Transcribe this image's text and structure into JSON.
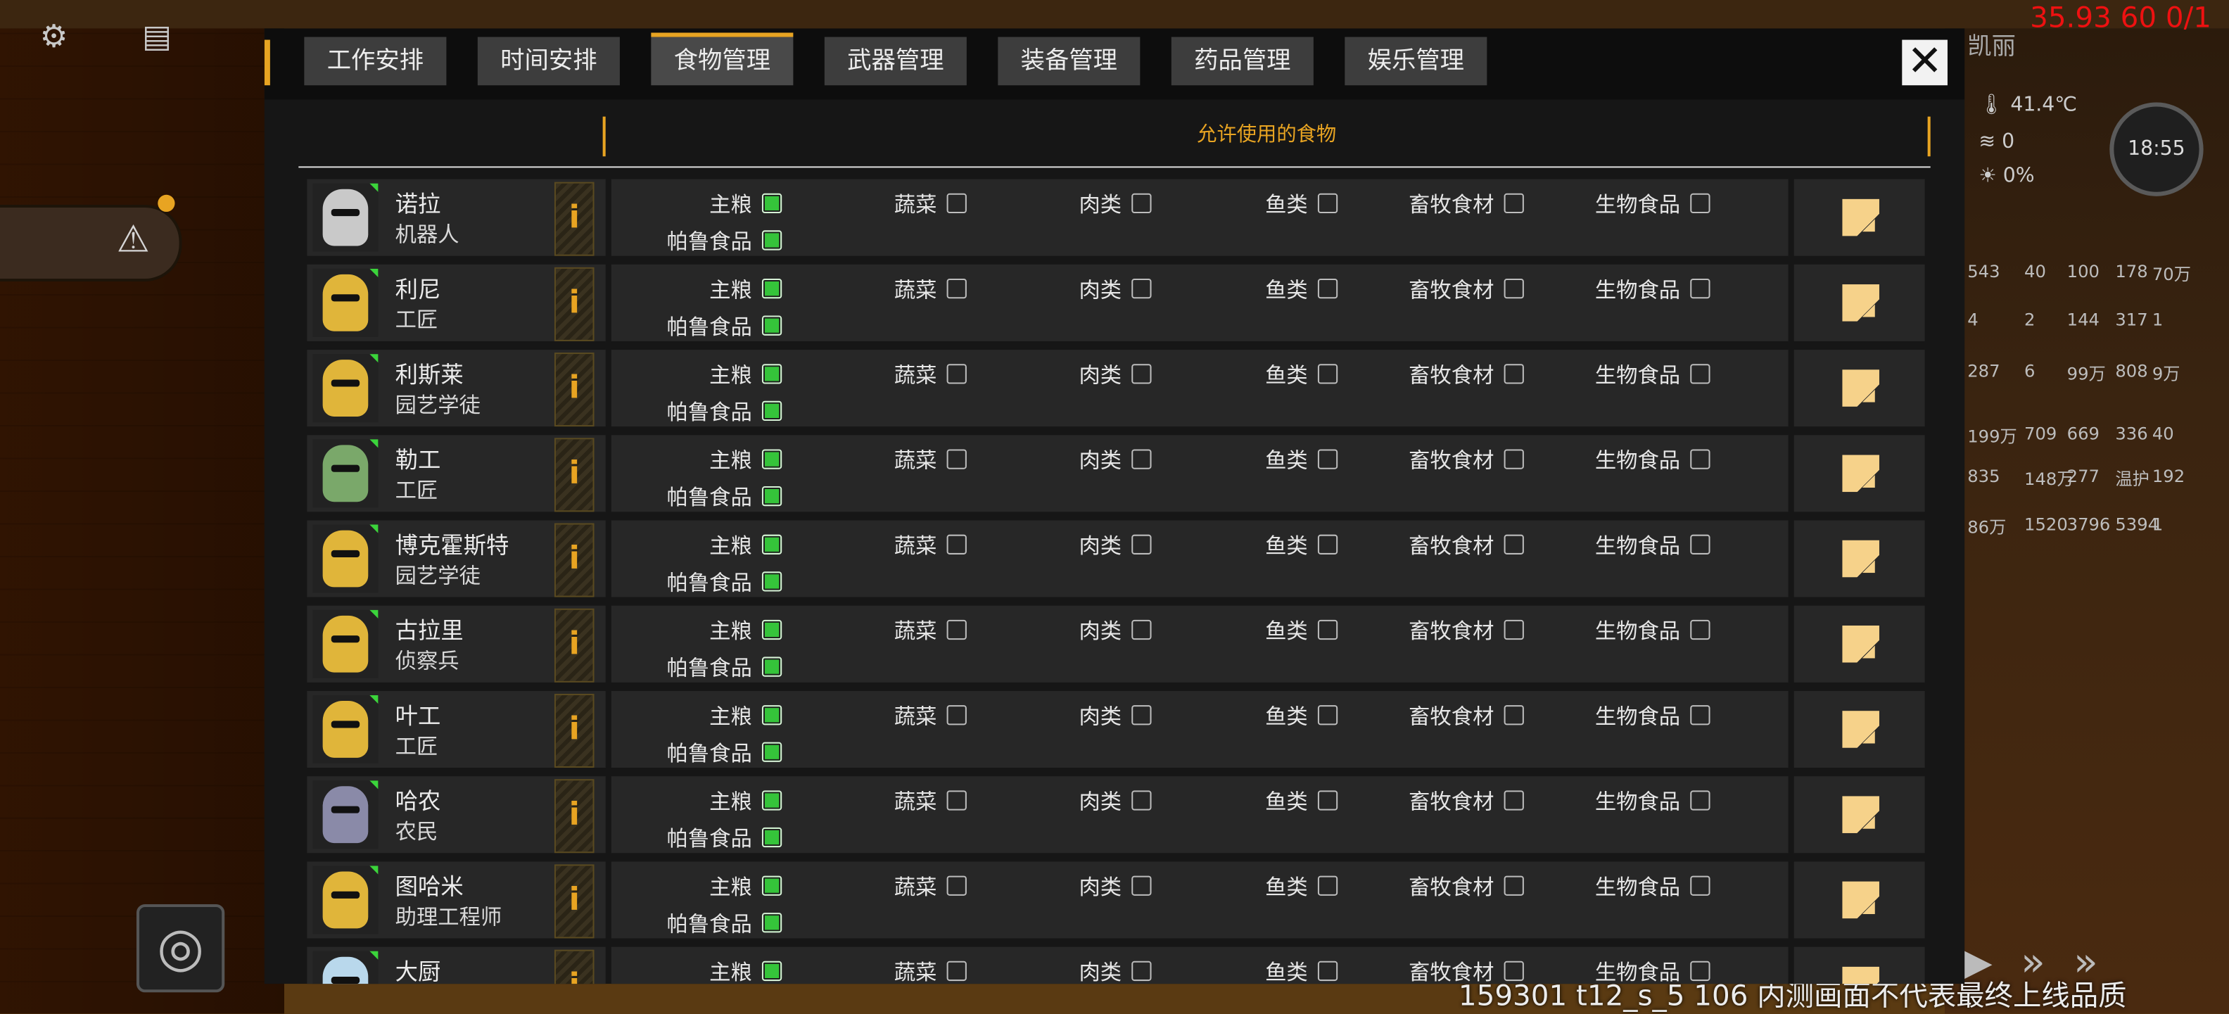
{
  "hud": {
    "top_stats": "35.93 60 0/1",
    "top_name": "凯丽",
    "temperature": "41.4℃",
    "wind": "0",
    "light": "0%",
    "clock": "18:55",
    "watermark": "159301 t12_s_5 106  内测画面不代表最终上线品质",
    "right_numbers": [
      "543",
      "40",
      "100",
      "178",
      "70万",
      "4",
      "2",
      "144",
      "317",
      "1",
      "287",
      "6",
      "99万",
      "808",
      "9万",
      "199万",
      "709",
      "669",
      "336",
      "40",
      "835",
      "148万",
      "277",
      "温护",
      "192",
      "86万",
      "1520",
      "3796",
      "5394",
      "1"
    ]
  },
  "tabs": [
    {
      "label": "工作安排",
      "active": false
    },
    {
      "label": "时间安排",
      "active": false
    },
    {
      "label": "食物管理",
      "active": true
    },
    {
      "label": "武器管理",
      "active": false
    },
    {
      "label": "装备管理",
      "active": false
    },
    {
      "label": "药品管理",
      "active": false
    },
    {
      "label": "娱乐管理",
      "active": false
    }
  ],
  "header": {
    "title": "允许使用的食物"
  },
  "food_types": [
    "主粮",
    "蔬菜",
    "肉类",
    "鱼类",
    "畜牧食材",
    "生物食品",
    "帕鲁食品"
  ],
  "rows": [
    {
      "name": "诺拉",
      "role": "机器人",
      "avatar_color": "#c9c9c9",
      "checked": [
        true,
        false,
        false,
        false,
        false,
        false,
        true
      ]
    },
    {
      "name": "利尼",
      "role": "工匠",
      "avatar_color": "#e0b53a",
      "checked": [
        true,
        false,
        false,
        false,
        false,
        false,
        true
      ]
    },
    {
      "name": "利斯莱",
      "role": "园艺学徒",
      "avatar_color": "#e0b53a",
      "checked": [
        true,
        false,
        false,
        false,
        false,
        false,
        true
      ]
    },
    {
      "name": "勒工",
      "role": "工匠",
      "avatar_color": "#7aa86a",
      "checked": [
        true,
        false,
        false,
        false,
        false,
        false,
        true
      ]
    },
    {
      "name": "博克霍斯特",
      "role": "园艺学徒",
      "avatar_color": "#e0b53a",
      "checked": [
        true,
        false,
        false,
        false,
        false,
        false,
        true
      ]
    },
    {
      "name": "古拉里",
      "role": "侦察兵",
      "avatar_color": "#e0b53a",
      "checked": [
        true,
        false,
        false,
        false,
        false,
        false,
        true
      ]
    },
    {
      "name": "叶工",
      "role": "工匠",
      "avatar_color": "#e0b53a",
      "checked": [
        true,
        false,
        false,
        false,
        false,
        false,
        true
      ]
    },
    {
      "name": "哈农",
      "role": "农民",
      "avatar_color": "#8a8aa8",
      "checked": [
        true,
        false,
        false,
        false,
        false,
        false,
        true
      ]
    },
    {
      "name": "图哈米",
      "role": "助理工程师",
      "avatar_color": "#e0b53a",
      "checked": [
        true,
        false,
        false,
        false,
        false,
        false,
        true
      ]
    },
    {
      "name": "大厨",
      "role": "",
      "avatar_color": "#b9d8ec",
      "checked": [
        true,
        false,
        false,
        false,
        false,
        false,
        true
      ]
    }
  ],
  "colors": {
    "accent": "#e8a422",
    "check_on": "#35c43a",
    "panel": "#161616",
    "row": "#272727"
  }
}
